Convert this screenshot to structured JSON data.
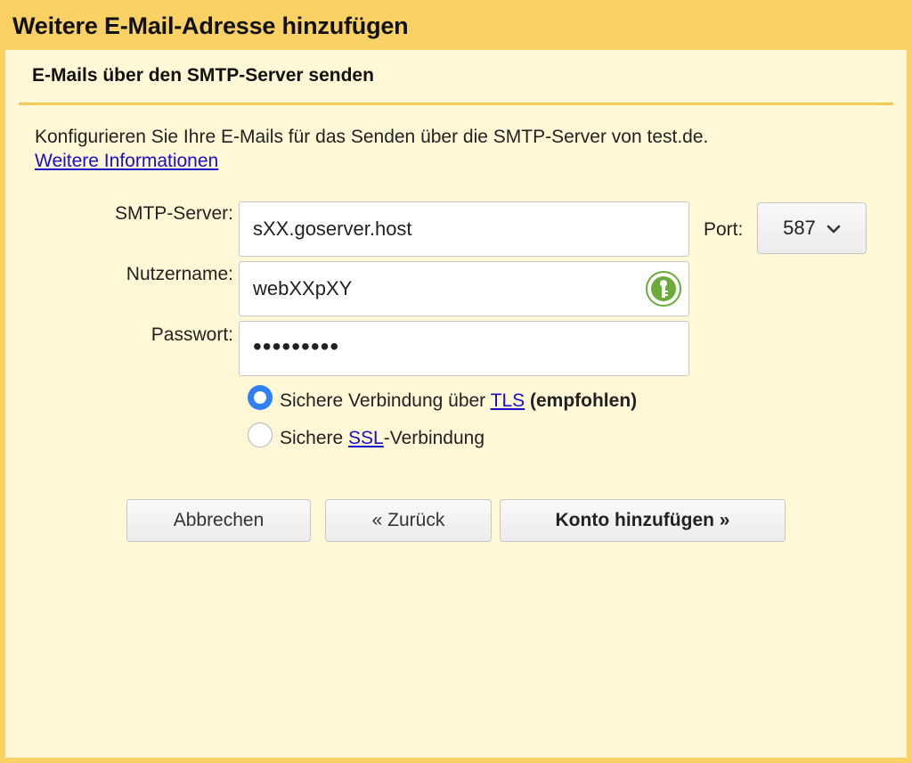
{
  "dialog": {
    "title": "Weitere E-Mail-Adresse hinzufügen",
    "section_title": "E-Mails über den SMTP-Server senden",
    "intro_text": "Konfigurieren Sie Ihre E-Mails für das Senden über die SMTP-Server von test.de.",
    "more_info_link": "Weitere Informationen"
  },
  "form": {
    "smtp_label": "SMTP-Server:",
    "smtp_value": "sXX.goserver.host",
    "port_label": "Port:",
    "port_value": "587",
    "username_label": "Nutzername:",
    "username_value": "webXXpXY",
    "password_label": "Passwort:",
    "password_mask": "•••••••••",
    "password_manager_icon": "key-icon"
  },
  "security": {
    "tls_prefix": "Sichere Verbindung über ",
    "tls_link": "TLS",
    "tls_suffix": "(empfohlen)",
    "tls_selected": true,
    "ssl_prefix": "Sichere ",
    "ssl_link": "SSL",
    "ssl_suffix": "-Verbindung",
    "ssl_selected": false
  },
  "actions": {
    "cancel_label": "Abbrechen",
    "back_label": "« Zurück",
    "add_label": "Konto hinzufügen »"
  },
  "colors": {
    "frame": "#fad165",
    "panel": "#fff8d6",
    "link": "#1a0dcc",
    "radio_selected": "#2f7ff6"
  }
}
